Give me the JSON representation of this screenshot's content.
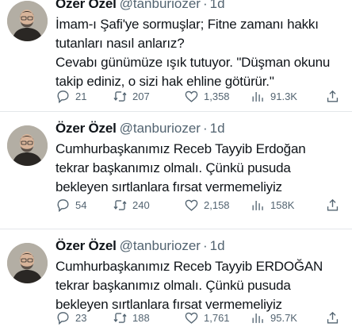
{
  "tweets": [
    {
      "author": "Özer Özel",
      "handle": "@tanburiozer",
      "separator": "·",
      "time": "1d",
      "text": "İmam-ı Şafi'ye sormuşlar; Fitne zamanı hakkı\ntutanları nasıl anlarız?\nCevabı günümüze ışık tutuyor. \"Düşman okunu\ntakip ediniz, o sizi hak ehline götürür.\"",
      "replies": "21",
      "retweets": "207",
      "likes": "1,358",
      "views": "91.3K"
    },
    {
      "author": "Özer Özel",
      "handle": "@tanburiozer",
      "separator": "·",
      "time": "1d",
      "text": "Cumhurbaşkanımız Receb Tayyib Erdoğan\ntekrar başkanımız olmalı. Çünkü pusuda\nbekleyen sırtlanlara fırsat vermemeliyiz",
      "replies": "54",
      "retweets": "240",
      "likes": "2,158",
      "views": "158K"
    },
    {
      "author": "Özer Özel",
      "handle": "@tanburiozer",
      "separator": "·",
      "time": "1d",
      "text": "Cumhurbaşkanımız Receb Tayyib ERDOĞAN\ntekrar başkanımız olmalı. Çünkü pusuda\nbekleyen sırtlanlara fırsat vermemeliyiz",
      "replies": "23",
      "retweets": "188",
      "likes": "1,761",
      "views": "95.7K"
    }
  ],
  "icons": {
    "reply": "reply-icon",
    "retweet": "retweet-icon",
    "like": "like-icon",
    "views": "views-icon",
    "share": "share-icon"
  },
  "colors": {
    "text": "#0f1419",
    "secondary": "#536471",
    "divider": "#e3e7ea",
    "background": "#ffffff"
  }
}
